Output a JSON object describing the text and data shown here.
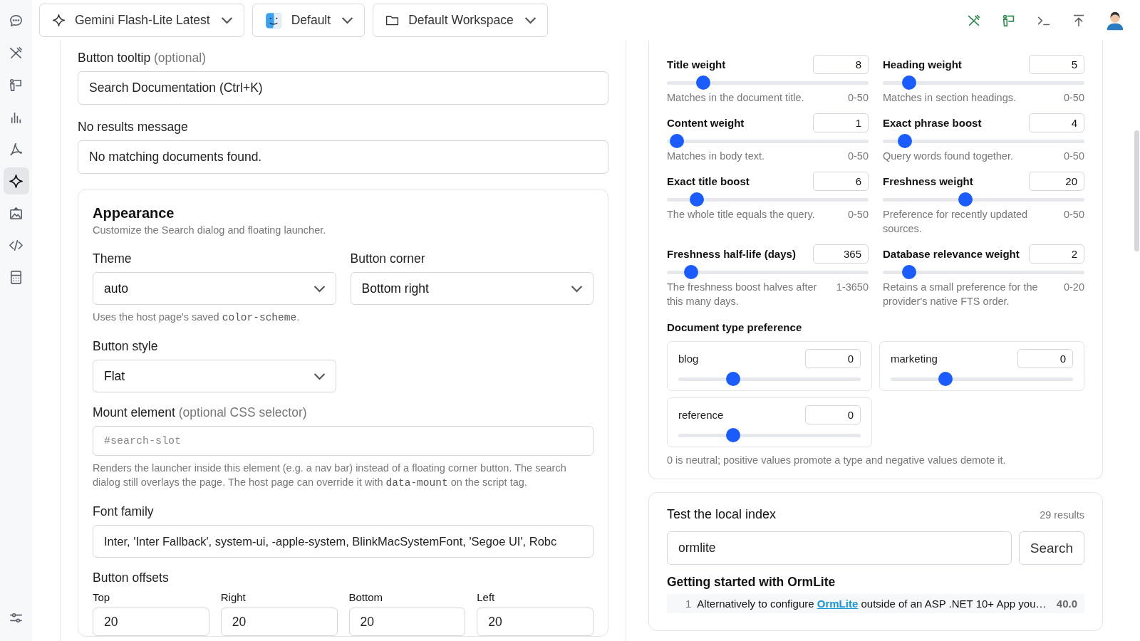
{
  "toolbar": {
    "model": "Gemini Flash-Lite Latest",
    "profile": "Default",
    "workspace": "Default Workspace"
  },
  "sidebar": {
    "items": [
      {
        "selected": false
      },
      {
        "selected": false
      },
      {
        "selected": false
      },
      {
        "selected": false
      },
      {
        "selected": false
      },
      {
        "selected": true
      },
      {
        "selected": false
      },
      {
        "selected": false
      },
      {
        "selected": false
      },
      {
        "selected": false
      }
    ]
  },
  "form": {
    "tooltip": {
      "label": "Button tooltip",
      "note": "(optional)",
      "value": "Search Documentation (Ctrl+K)"
    },
    "no_results": {
      "label": "No results message",
      "value": "No matching documents found."
    },
    "appearance": {
      "title": "Appearance",
      "subtitle": "Customize the Search dialog and floating launcher.",
      "theme": {
        "label": "Theme",
        "value": "auto",
        "help": [
          {
            "text": "Uses the host page's saved "
          },
          {
            "code": "color-scheme"
          },
          {
            "text": "."
          }
        ]
      },
      "corner": {
        "label": "Button corner",
        "value": "Bottom right"
      },
      "style": {
        "label": "Button style",
        "value": "Flat"
      },
      "mount": {
        "label": "Mount element",
        "note": "(optional CSS selector)",
        "placeholder": "#search-slot",
        "help": [
          {
            "text": "Renders the launcher inside this element (e.g. a nav bar) instead of a floating corner button. The search dialog still overlays the page. The host page can override it with "
          },
          {
            "code": "data-mount"
          },
          {
            "text": " on the script tag."
          }
        ]
      },
      "font": {
        "label": "Font family",
        "value": "Inter, 'Inter Fallback', system-ui, -apple-system, BlinkMacSystemFont, 'Segoe UI', Robc"
      },
      "offsets": {
        "label": "Button offsets",
        "fields": [
          {
            "label": "Top",
            "value": "20"
          },
          {
            "label": "Right",
            "value": "20"
          },
          {
            "label": "Bottom",
            "value": "20"
          },
          {
            "label": "Left",
            "value": "20"
          }
        ]
      }
    }
  },
  "ranking": {
    "weights": [
      {
        "label": "Title weight",
        "value": "8",
        "level": 0.18,
        "help": "Matches in the document title.",
        "range": "0-50"
      },
      {
        "label": "Heading weight",
        "value": "5",
        "level": 0.13,
        "help": "Matches in section headings.",
        "range": "0-50"
      },
      {
        "label": "Content weight",
        "value": "1",
        "level": 0.05,
        "help": "Matches in body text.",
        "range": "0-50"
      },
      {
        "label": "Exact phrase boost",
        "value": "4",
        "level": 0.11,
        "help": "Query words found together.",
        "range": "0-50"
      },
      {
        "label": "Exact title boost",
        "value": "6",
        "level": 0.15,
        "help": "The whole title equals the query.",
        "range": "0-50"
      },
      {
        "label": "Freshness weight",
        "value": "20",
        "level": 0.41,
        "help": "Preference for recently updated sources.",
        "range": "0-50"
      },
      {
        "label": "Freshness half-life (days)",
        "value": "365",
        "level": 0.12,
        "help": "The freshness boost halves after this many days.",
        "range": "1-3650"
      },
      {
        "label": "Database relevance weight",
        "value": "2",
        "level": 0.13,
        "help": "Retains a small preference for the provider's native FTS order.",
        "range": "0-20"
      }
    ],
    "doc_types": {
      "title": "Document type preference",
      "items": [
        {
          "label": "blog",
          "value": "0",
          "level": 0.3
        },
        {
          "label": "marketing",
          "value": "0",
          "level": 0.3
        },
        {
          "label": "reference",
          "value": "0",
          "level": 0.3
        }
      ],
      "note": "0 is neutral; positive values promote a type and negative values demote it."
    }
  },
  "test": {
    "title": "Test the local index",
    "count": "29 results",
    "query": "ormlite",
    "button": "Search",
    "groups": [
      {
        "heading": "Getting started with OrmLite",
        "rows": [
          {
            "number": "1",
            "before": "Alternatively to configure ",
            "link": "OrmLite",
            "after": " outside of an ASP .NET 10+ App you…",
            "score": "40.0"
          }
        ]
      }
    ]
  }
}
